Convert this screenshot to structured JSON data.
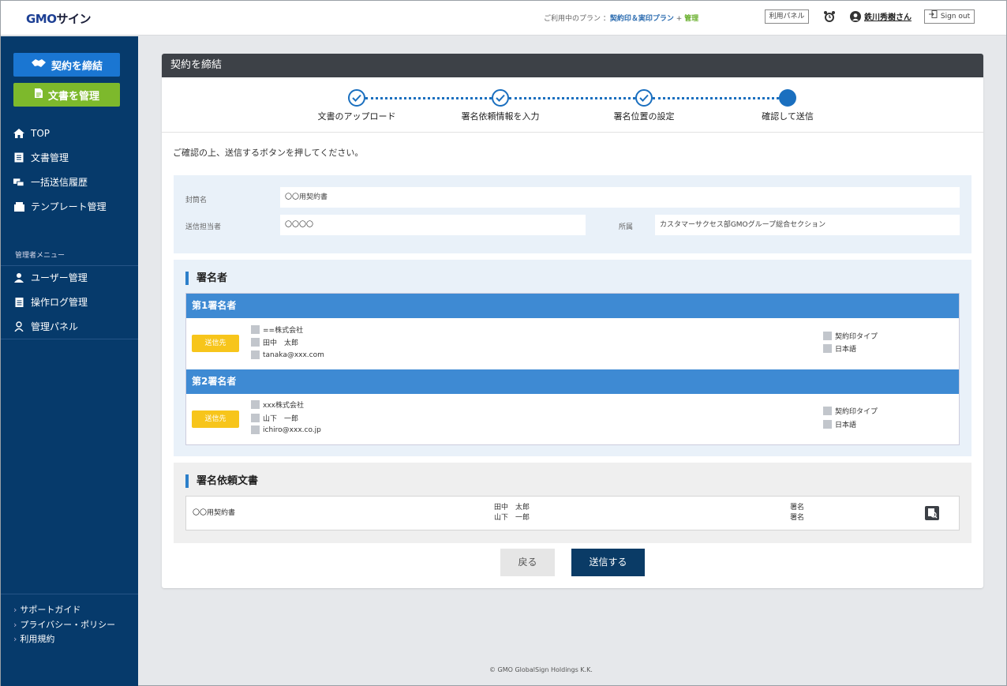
{
  "header": {
    "logo_main": "GMO",
    "logo_rest": "サイン",
    "plan_prefix": "ご利用中のプラン ：",
    "plan_name": "契約印＆実印プラン",
    "plan_plus": " + ",
    "plan_admin": "管理",
    "panel_button": "利用パネル",
    "user_name": "鉄川秀樹さん",
    "signout": "Sign out"
  },
  "sidebar": {
    "btn_contract": "契約を締結",
    "btn_documents": "文書を管理",
    "nav": [
      {
        "label": "TOP",
        "icon": "home-icon"
      },
      {
        "label": "文書管理",
        "icon": "document-list-icon"
      },
      {
        "label": "一括送信履歴",
        "icon": "batch-send-icon"
      },
      {
        "label": "テンプレート管理",
        "icon": "template-icon"
      }
    ],
    "admin_title": "管理者メニュー",
    "admin_nav": [
      {
        "label": "ユーザー管理",
        "icon": "user-icon"
      },
      {
        "label": "操作ログ管理",
        "icon": "log-icon"
      },
      {
        "label": "管理パネル",
        "icon": "admin-panel-icon"
      }
    ],
    "footer_links": [
      "サポートガイド",
      "プライバシー・ポリシー",
      "利用規約"
    ]
  },
  "card": {
    "title": "契約を締結",
    "steps": [
      "文書のアップロード",
      "署名依頼情報を入力",
      "署名位置の設定",
      "確認して送信"
    ],
    "confirm_message": "ご確認の上、送信するボタンを押してください。",
    "envelope_label": "封筒名",
    "envelope_value": "〇〇用契約書",
    "sender_label": "送信担当者",
    "sender_value": "〇〇〇〇",
    "dept_label": "所属",
    "dept_value": "カスタマーサクセス部GMOグループ総合セクション"
  },
  "signers": {
    "section_title": "署名者",
    "badge": "送信先",
    "list": [
      {
        "title": "第1署名者",
        "company": "==株式会社",
        "name": "田中　太郎",
        "email": "tanaka@xxx.com",
        "type": "契約印タイプ",
        "lang": "日本語"
      },
      {
        "title": "第2署名者",
        "company": "xxx株式会社",
        "name": "山下　一郎",
        "email": "ichiro@xxx.co.jp",
        "type": "契約印タイプ",
        "lang": "日本語"
      }
    ]
  },
  "documents": {
    "section_title": "署名依頼文書",
    "row": {
      "doc_name": "〇〇用契約書",
      "signer1": "田中　太郎",
      "signer2": "山下　一郎",
      "sign1": "署名",
      "sign2": "署名"
    }
  },
  "actions": {
    "back": "戻る",
    "send": "送信する"
  },
  "footer": {
    "copyright": "© GMO GlobalSign Holdings K.K."
  },
  "colors": {
    "sidebar": "#063a6b",
    "primary": "#1a6fbf",
    "signer_bar": "#3e8ad3",
    "badge": "#f7c51b",
    "send_button": "#0a3b66"
  }
}
